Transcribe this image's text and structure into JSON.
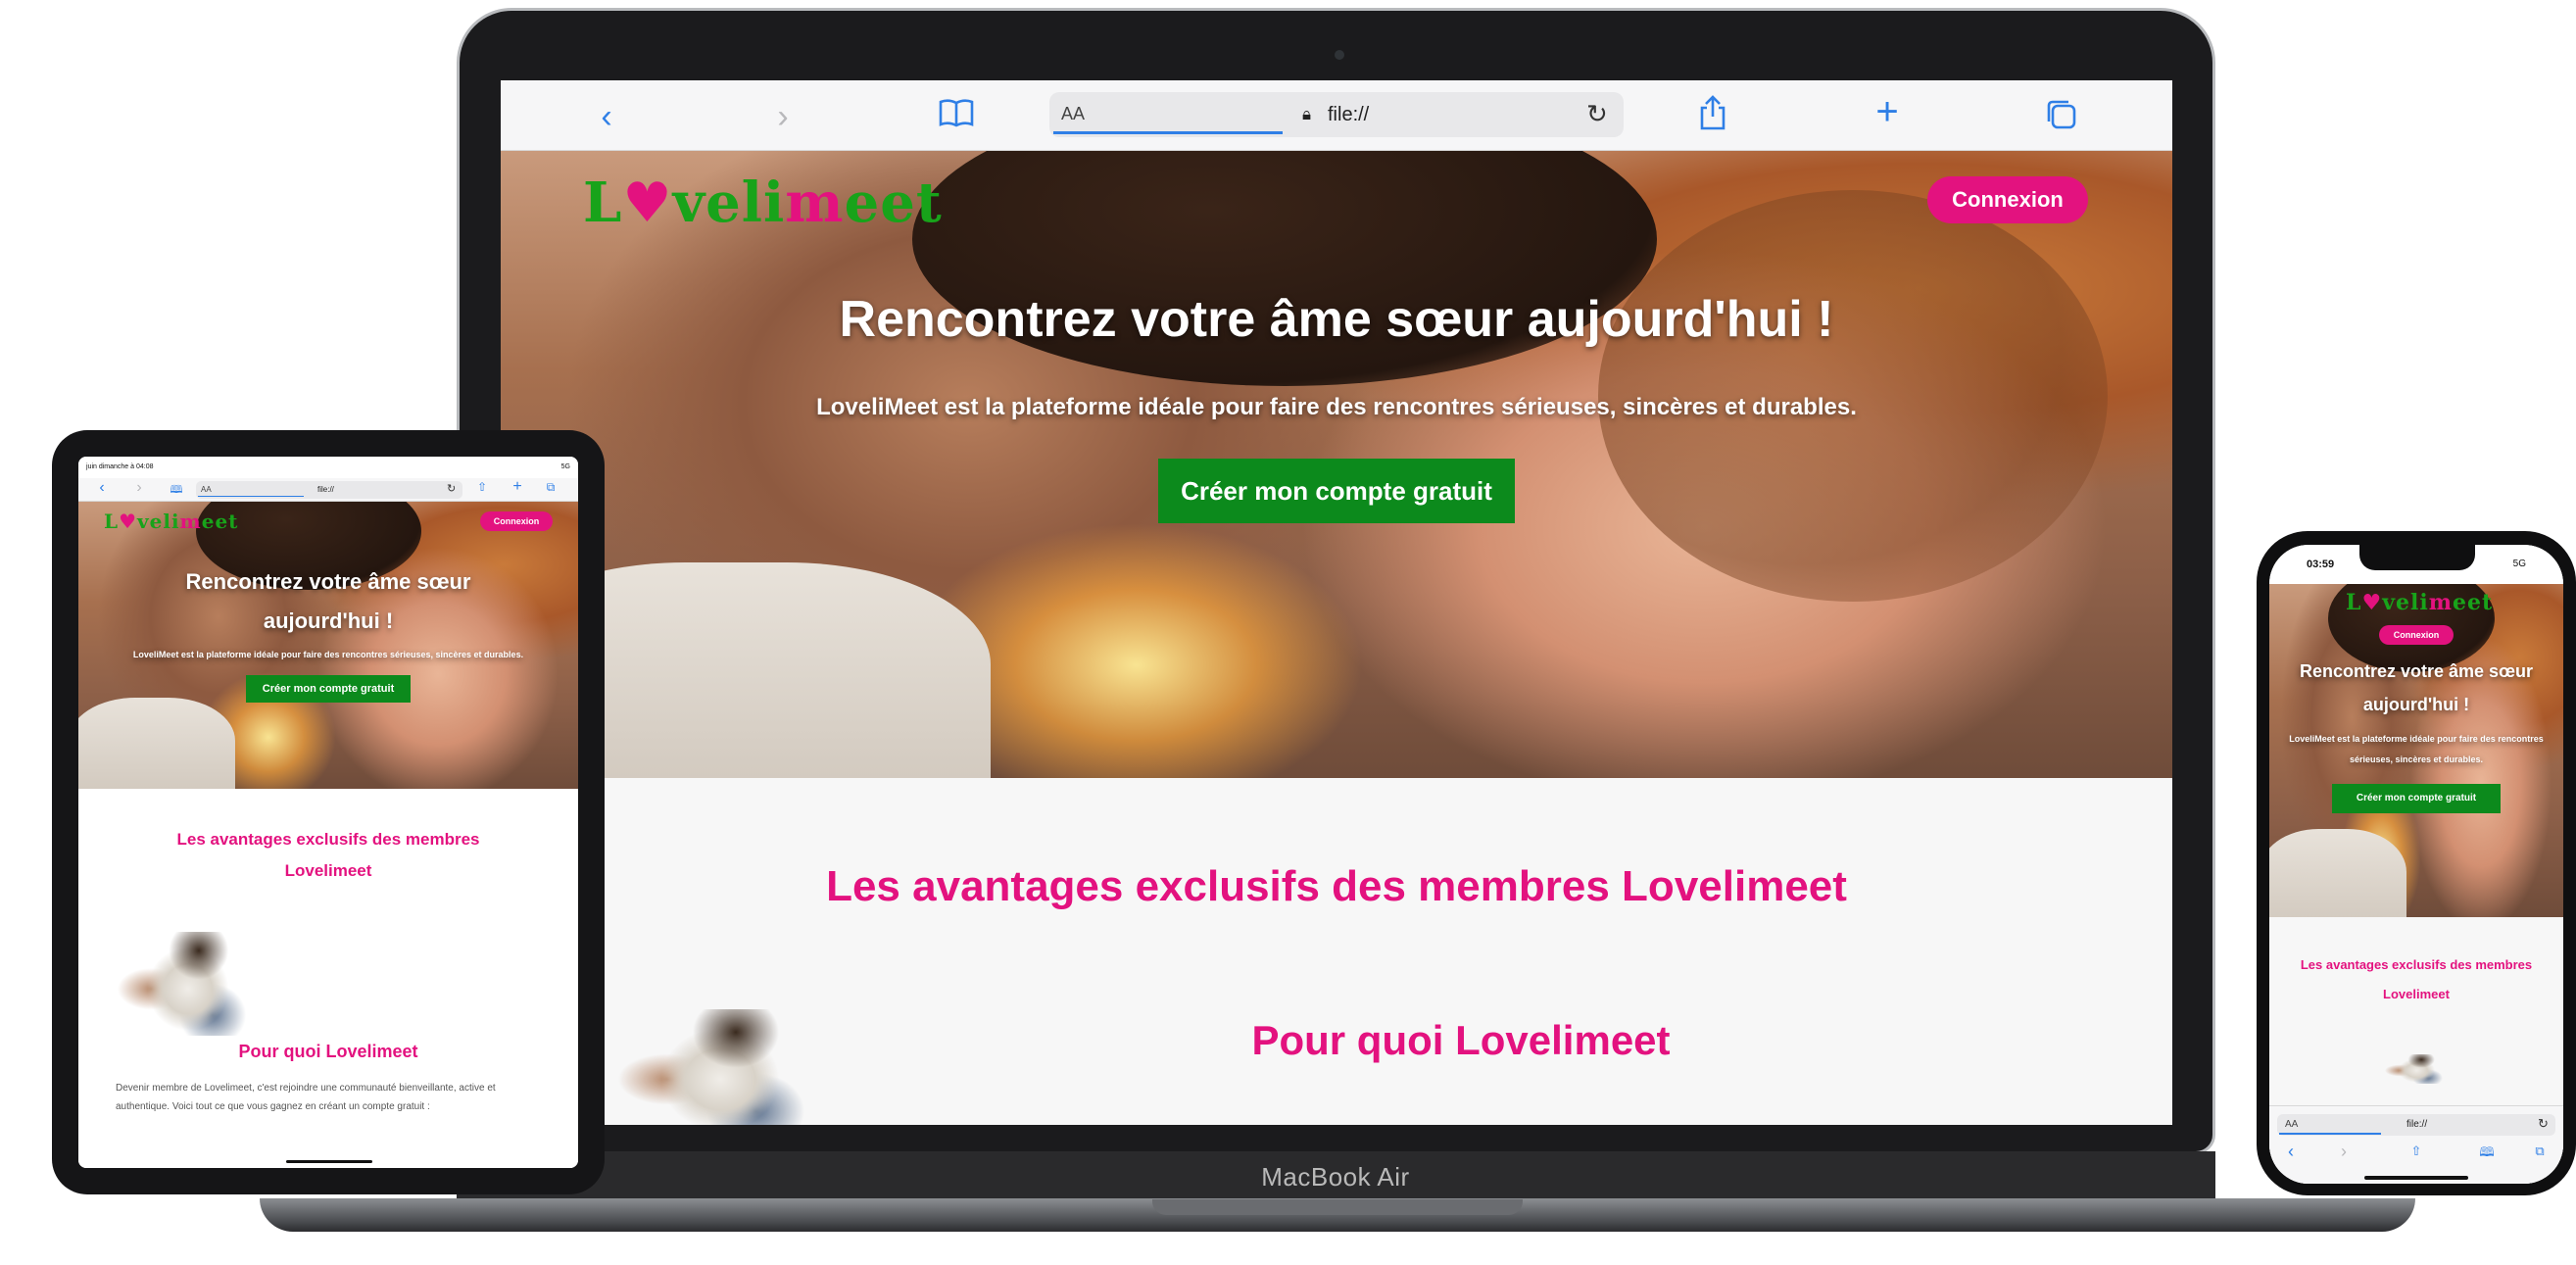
{
  "site": {
    "logo": "Lovelimeet",
    "login": "Connexion",
    "hero_title": "Rencontrez votre âme sœur aujourd'hui !",
    "hero_subtitle": "LoveliMeet est la plateforme idéale pour faire des rencontres sérieuses, sincères et durables.",
    "cta": "Créer mon compte gratuit",
    "section_title": "Les avantages exclusifs des membres Lovelimeet",
    "why_title": "Pour quoi Lovelimeet",
    "why_text": "Devenir membre de Lovelimeet, c'est rejoindre une communauté bienveillante, active et authentique. Voici tout ce que vous gagnez en créant un compte gratuit :",
    "colors": {
      "brand_pink": "#e3127f",
      "brand_green": "#18a31a",
      "cta_green": "#0c8a1c"
    }
  },
  "browser": {
    "aa": "AA",
    "url": "file://",
    "icons": [
      "back-icon",
      "forward-icon",
      "bookmarks-icon",
      "lock-icon",
      "reload-icon",
      "share-icon",
      "new-tab-icon",
      "tabs-icon"
    ]
  },
  "macbook": {
    "label": "MacBook Air"
  },
  "ipad": {
    "status_time": "juin dimanche à 04:08",
    "status_right": "5G"
  },
  "iphone": {
    "status_time": "03:59",
    "status_right": "5G"
  }
}
